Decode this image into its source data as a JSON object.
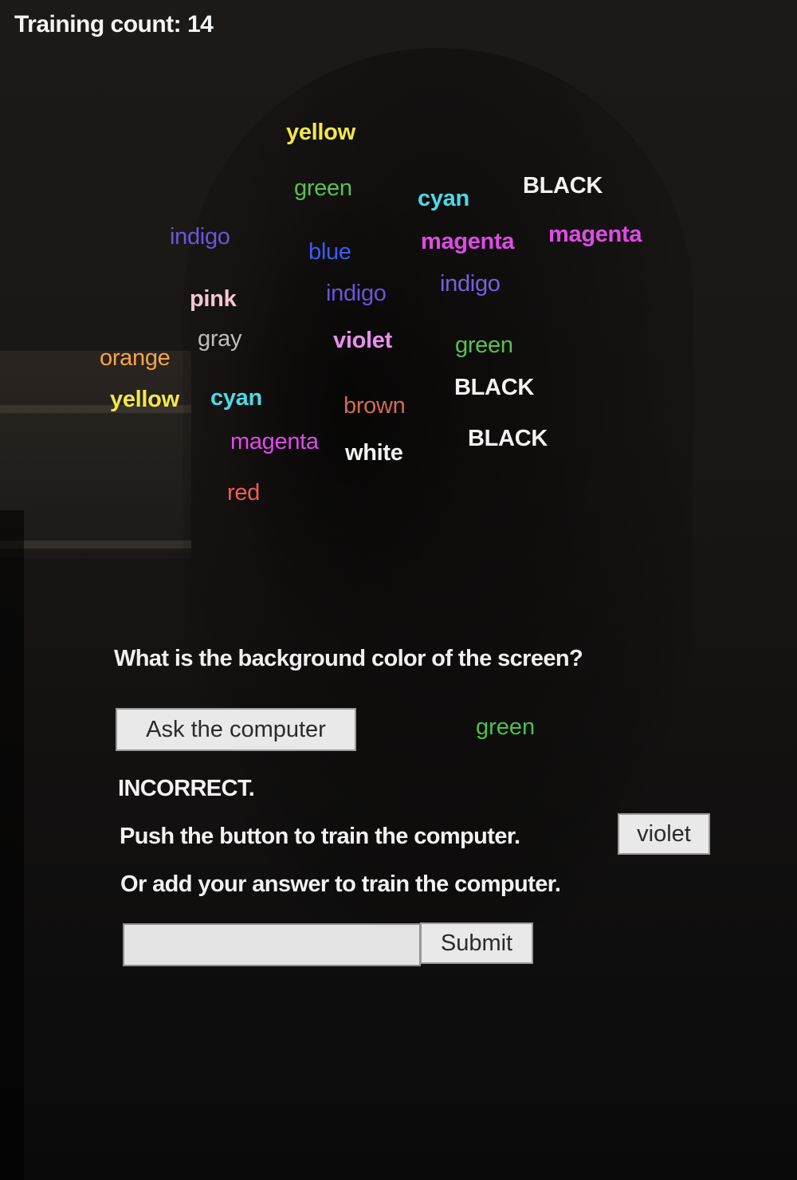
{
  "training_count_label": "Training count: 14",
  "words": [
    {
      "text": "yellow",
      "color": "#f2e84a"
    },
    {
      "text": "green",
      "color": "#58c152"
    },
    {
      "text": "cyan",
      "color": "#4fd8e6"
    },
    {
      "text": "BLACK",
      "color": "#f3f3f3"
    },
    {
      "text": "indigo",
      "color": "#6a55dc"
    },
    {
      "text": "blue",
      "color": "#3a5cf0"
    },
    {
      "text": "magenta",
      "color": "#e04ae8"
    },
    {
      "text": "magenta",
      "color": "#e04ae8"
    },
    {
      "text": "pink",
      "color": "#f5c6d4"
    },
    {
      "text": "indigo",
      "color": "#6a55dc"
    },
    {
      "text": "indigo",
      "color": "#7a5ee0"
    },
    {
      "text": "gray",
      "color": "#bdbdbd"
    },
    {
      "text": "violet",
      "color": "#ea8ff0"
    },
    {
      "text": "green",
      "color": "#58c152"
    },
    {
      "text": "orange",
      "color": "#f5a545"
    },
    {
      "text": "yellow",
      "color": "#f2e84a"
    },
    {
      "text": "cyan",
      "color": "#4fd8e6"
    },
    {
      "text": "brown",
      "color": "#d46a52"
    },
    {
      "text": "BLACK",
      "color": "#f3f3f3"
    },
    {
      "text": "magenta",
      "color": "#e04ae8"
    },
    {
      "text": "white",
      "color": "#f3f3f3"
    },
    {
      "text": "BLACK",
      "color": "#f3f3f3"
    },
    {
      "text": "red",
      "color": "#f25b5b"
    }
  ],
  "question": "What is the background color of the screen?",
  "ask_button_label": "Ask the computer",
  "computer_answer": "green",
  "computer_answer_color": "#4cc04c",
  "verdict": "INCORRECT.",
  "push_instruction": "Push the button to train the computer.",
  "suggested_answer_button": "violet",
  "add_answer_instruction": "Or add your answer to train the computer.",
  "answer_input": {
    "value": "",
    "placeholder": ""
  },
  "submit_button_label": "Submit"
}
